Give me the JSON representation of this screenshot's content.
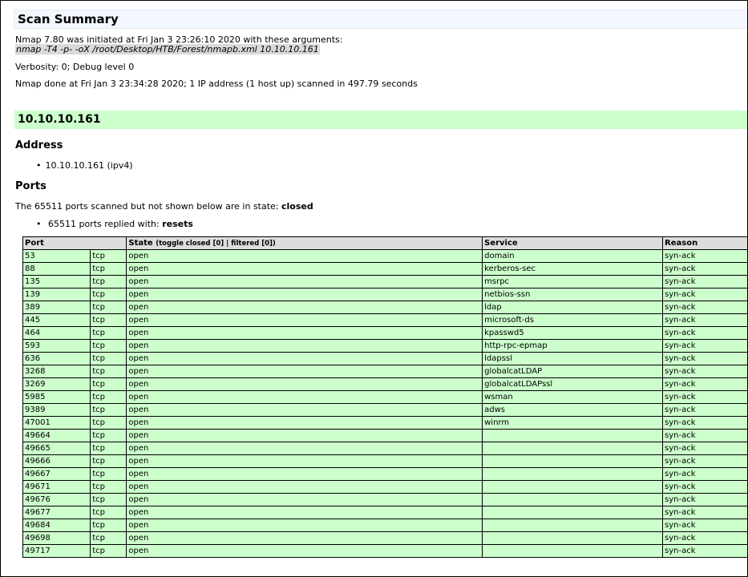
{
  "summary": {
    "title": "Scan Summary",
    "initiated": "Nmap 7.80 was initiated at Fri Jan 3 23:26:10 2020 with these arguments:",
    "command": "nmap -T4 -p- -oX /root/Desktop/HTB/Forest/nmapb.xml 10.10.10.161",
    "verbosity": "Verbosity: 0; Debug level 0",
    "done": "Nmap done at Fri Jan 3 23:34:28 2020; 1 IP address (1 host up) scanned in 497.79 seconds"
  },
  "host": {
    "ip": "10.10.10.161",
    "address_heading": "Address",
    "address_item": "10.10.10.161 (ipv4)",
    "ports_heading": "Ports",
    "state_text": "The 65511 ports scanned but not shown below are in state:",
    "state_value": "closed",
    "replied_text": "65511 ports replied with:",
    "replied_value": "resets"
  },
  "table": {
    "headers": {
      "port": "Port",
      "state": "State",
      "toggle": "(toggle closed [0] | filtered [0])",
      "service": "Service",
      "reason": "Reason"
    },
    "rows": [
      {
        "port": "53",
        "proto": "tcp",
        "state": "open",
        "service": "domain",
        "reason": "syn-ack"
      },
      {
        "port": "88",
        "proto": "tcp",
        "state": "open",
        "service": "kerberos-sec",
        "reason": "syn-ack"
      },
      {
        "port": "135",
        "proto": "tcp",
        "state": "open",
        "service": "msrpc",
        "reason": "syn-ack"
      },
      {
        "port": "139",
        "proto": "tcp",
        "state": "open",
        "service": "netbios-ssn",
        "reason": "syn-ack"
      },
      {
        "port": "389",
        "proto": "tcp",
        "state": "open",
        "service": "ldap",
        "reason": "syn-ack"
      },
      {
        "port": "445",
        "proto": "tcp",
        "state": "open",
        "service": "microsoft-ds",
        "reason": "syn-ack"
      },
      {
        "port": "464",
        "proto": "tcp",
        "state": "open",
        "service": "kpasswd5",
        "reason": "syn-ack"
      },
      {
        "port": "593",
        "proto": "tcp",
        "state": "open",
        "service": "http-rpc-epmap",
        "reason": "syn-ack"
      },
      {
        "port": "636",
        "proto": "tcp",
        "state": "open",
        "service": "ldapssl",
        "reason": "syn-ack"
      },
      {
        "port": "3268",
        "proto": "tcp",
        "state": "open",
        "service": "globalcatLDAP",
        "reason": "syn-ack"
      },
      {
        "port": "3269",
        "proto": "tcp",
        "state": "open",
        "service": "globalcatLDAPssl",
        "reason": "syn-ack"
      },
      {
        "port": "5985",
        "proto": "tcp",
        "state": "open",
        "service": "wsman",
        "reason": "syn-ack"
      },
      {
        "port": "9389",
        "proto": "tcp",
        "state": "open",
        "service": "adws",
        "reason": "syn-ack"
      },
      {
        "port": "47001",
        "proto": "tcp",
        "state": "open",
        "service": "winrm",
        "reason": "syn-ack"
      },
      {
        "port": "49664",
        "proto": "tcp",
        "state": "open",
        "service": "",
        "reason": "syn-ack"
      },
      {
        "port": "49665",
        "proto": "tcp",
        "state": "open",
        "service": "",
        "reason": "syn-ack"
      },
      {
        "port": "49666",
        "proto": "tcp",
        "state": "open",
        "service": "",
        "reason": "syn-ack"
      },
      {
        "port": "49667",
        "proto": "tcp",
        "state": "open",
        "service": "",
        "reason": "syn-ack"
      },
      {
        "port": "49671",
        "proto": "tcp",
        "state": "open",
        "service": "",
        "reason": "syn-ack"
      },
      {
        "port": "49676",
        "proto": "tcp",
        "state": "open",
        "service": "",
        "reason": "syn-ack"
      },
      {
        "port": "49677",
        "proto": "tcp",
        "state": "open",
        "service": "",
        "reason": "syn-ack"
      },
      {
        "port": "49684",
        "proto": "tcp",
        "state": "open",
        "service": "",
        "reason": "syn-ack"
      },
      {
        "port": "49698",
        "proto": "tcp",
        "state": "open",
        "service": "",
        "reason": "syn-ack"
      },
      {
        "port": "49717",
        "proto": "tcp",
        "state": "open",
        "service": "",
        "reason": "syn-ack"
      }
    ]
  },
  "colors": {
    "host_header": "#ccffcc",
    "row_open": "#ccffcc",
    "header_row": "#dddddd",
    "summary_bg": "#f3f7ff"
  }
}
